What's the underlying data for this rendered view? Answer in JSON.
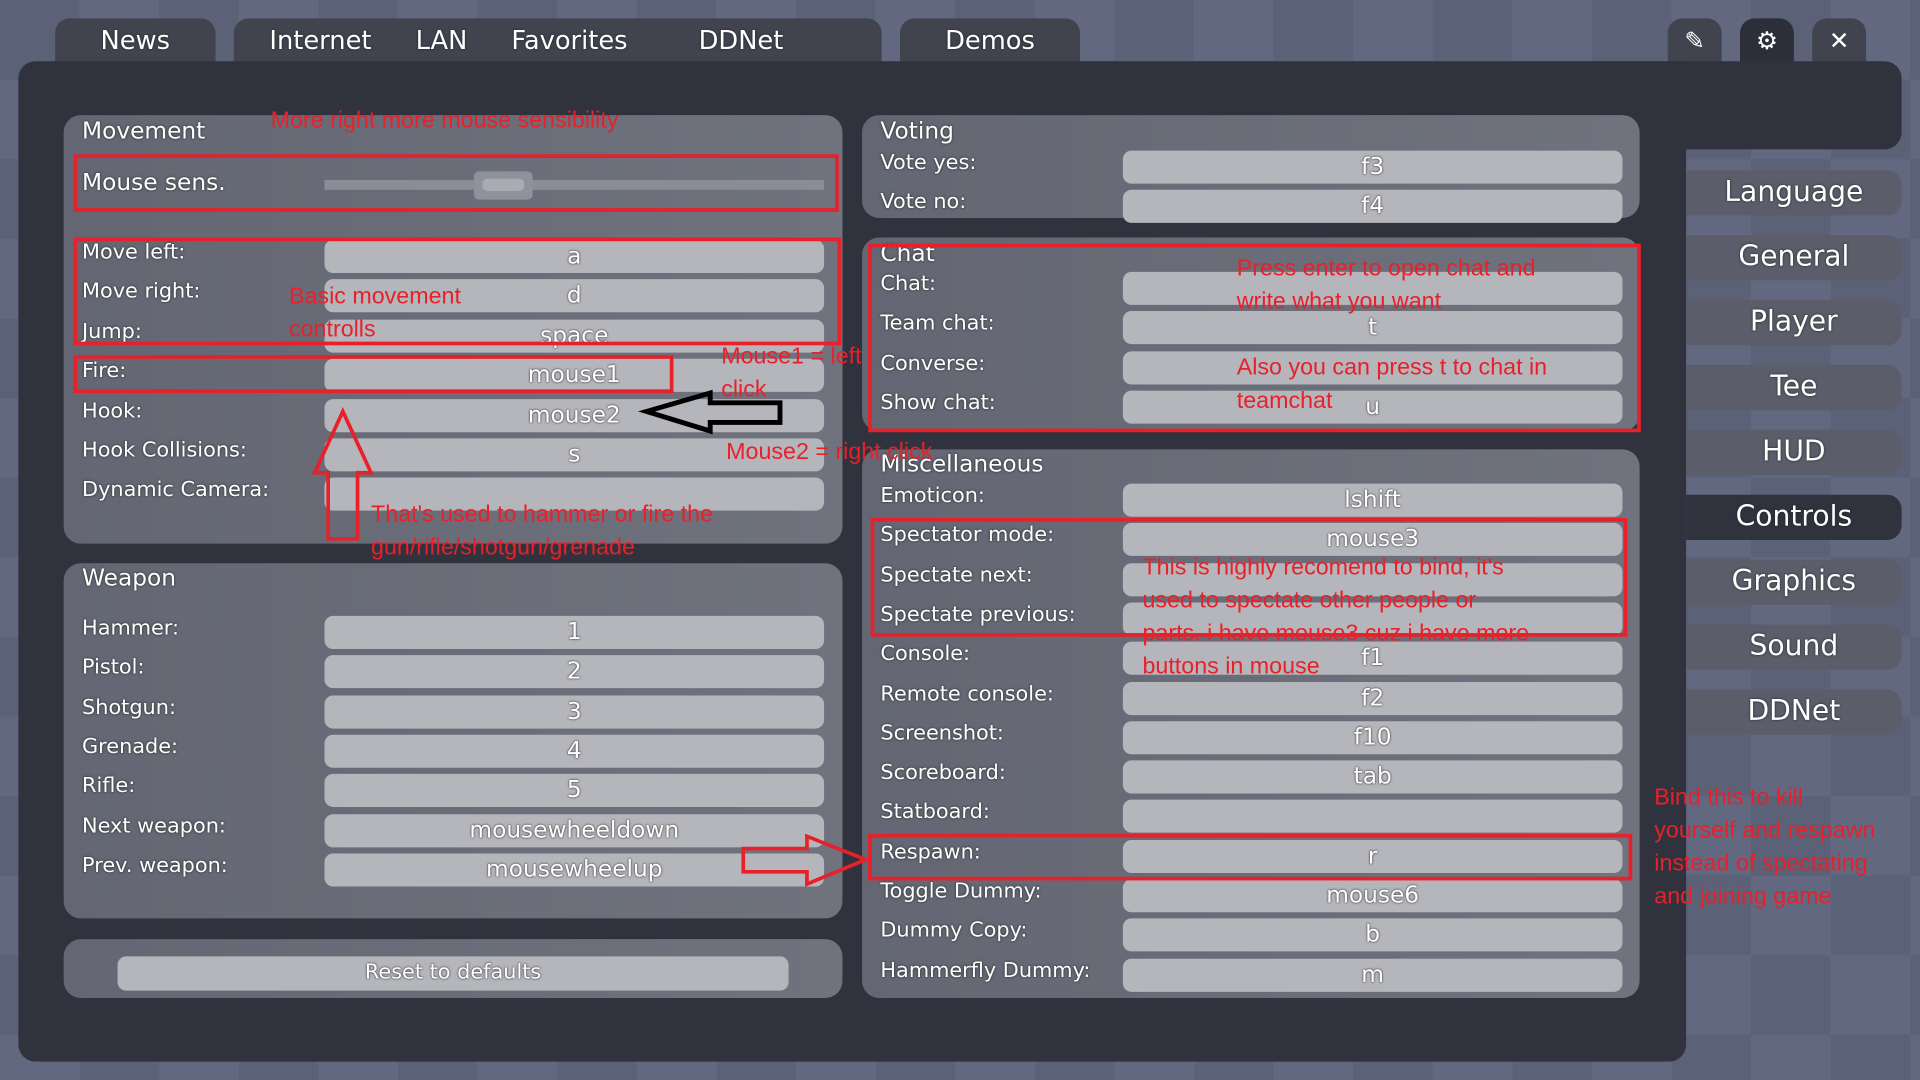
{
  "tabs": {
    "news": "News",
    "internet": "Internet",
    "lan": "LAN",
    "favorites": "Favorites",
    "ddnet": "DDNet",
    "demos": "Demos"
  },
  "top_icons": [
    "pencil-icon",
    "gear-icon",
    "close-icon"
  ],
  "movement": {
    "title": "Movement",
    "mouse_sens_label": "Mouse sens.",
    "mouse_sens_value": 0.34,
    "rows": [
      {
        "label": "Move left:",
        "value": "a"
      },
      {
        "label": "Move right:",
        "value": "d"
      },
      {
        "label": "Jump:",
        "value": "space"
      },
      {
        "label": "Fire:",
        "value": "mouse1"
      },
      {
        "label": "Hook:",
        "value": "mouse2"
      },
      {
        "label": "Hook Collisions:",
        "value": "s"
      },
      {
        "label": "Dynamic Camera:",
        "value": ""
      }
    ]
  },
  "weapon": {
    "title": "Weapon",
    "rows": [
      {
        "label": "Hammer:",
        "value": "1"
      },
      {
        "label": "Pistol:",
        "value": "2"
      },
      {
        "label": "Shotgun:",
        "value": "3"
      },
      {
        "label": "Grenade:",
        "value": "4"
      },
      {
        "label": "Rifle:",
        "value": "5"
      },
      {
        "label": "Next weapon:",
        "value": "mousewheeldown"
      },
      {
        "label": "Prev. weapon:",
        "value": "mousewheelup"
      }
    ]
  },
  "reset_label": "Reset to defaults",
  "voting": {
    "title": "Voting",
    "rows": [
      {
        "label": "Vote yes:",
        "value": "f3"
      },
      {
        "label": "Vote no:",
        "value": "f4"
      }
    ]
  },
  "chat": {
    "title": "Chat",
    "rows": [
      {
        "label": "Chat:",
        "value": ""
      },
      {
        "label": "Team chat:",
        "value": "t"
      },
      {
        "label": "Converse:",
        "value": ""
      },
      {
        "label": "Show chat:",
        "value": "u"
      }
    ]
  },
  "misc": {
    "title": "Miscellaneous",
    "rows": [
      {
        "label": "Emoticon:",
        "value": "lshift"
      },
      {
        "label": "Spectator mode:",
        "value": "mouse3"
      },
      {
        "label": "Spectate next:",
        "value": ""
      },
      {
        "label": "Spectate previous:",
        "value": ""
      },
      {
        "label": "Console:",
        "value": "f1"
      },
      {
        "label": "Remote console:",
        "value": "f2"
      },
      {
        "label": "Screenshot:",
        "value": "f10"
      },
      {
        "label": "Scoreboard:",
        "value": "tab"
      },
      {
        "label": "Statboard:",
        "value": ""
      },
      {
        "label": "Respawn:",
        "value": "r"
      },
      {
        "label": "Toggle Dummy:",
        "value": "mouse6"
      },
      {
        "label": "Dummy Copy:",
        "value": "b"
      },
      {
        "label": "Hammerfly Dummy:",
        "value": "m"
      }
    ]
  },
  "settings_menu": [
    {
      "label": "Language"
    },
    {
      "label": "General"
    },
    {
      "label": "Player"
    },
    {
      "label": "Tee"
    },
    {
      "label": "HUD"
    },
    {
      "label": "Controls",
      "active": true
    },
    {
      "label": "Graphics"
    },
    {
      "label": "Sound"
    },
    {
      "label": "DDNet"
    }
  ],
  "annotations": {
    "mouse_sens": "More right more mouse sensibility",
    "movement": "Basic movement\ncontrolls",
    "mouse1": "Mouse1 = left\nclick",
    "mouse2": "Mouse2 = right click",
    "fire": "That's used to hammer or fire the\ngun/rifle/shotgun/grenade",
    "chat1": "Press enter to open chat and\nwrite what you want",
    "chat2": "Also you can press t to chat in\nteamchat",
    "spectate": "This is highly recomend to bind, it's\nused to spectate other people or\nparts. i have mouse3 cuz i have more\nbuttons in mouse",
    "respawn": "Bind this to kill\nyourself and respawn\ninstead of spectating\nand joining game"
  },
  "colors": {
    "annotation": "#e8202a",
    "panel": "#30333e",
    "field": "#b5b6bb"
  }
}
